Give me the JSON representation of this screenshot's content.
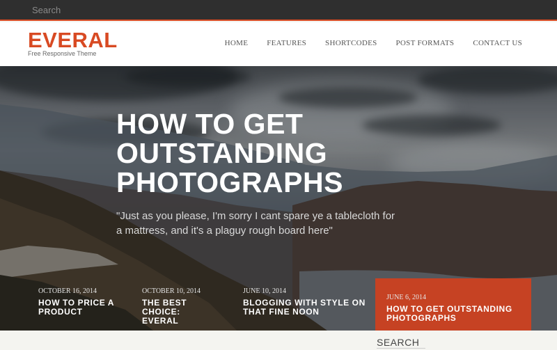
{
  "topbar": {
    "search_placeholder": "Search"
  },
  "header": {
    "logo": "EVERAL",
    "tagline": "Free Responsive Theme",
    "nav": [
      "HOME",
      "FEATURES",
      "SHORTCODES",
      "POST FORMATS",
      "CONTACT US"
    ]
  },
  "hero": {
    "title": "HOW TO GET OUTSTANDING PHOTOGRAPHS",
    "quote": "\"Just as you please, I'm sorry I cant spare ye a tablecloth for a mattress, and it's a plaguy rough board here\""
  },
  "posts": [
    {
      "date": "OCTOBER 16, 2014",
      "title": "HOW TO PRICE A PRODUCT"
    },
    {
      "date": "OCTOBER 10, 2014",
      "title": "THE BEST CHOICE: EVERAL"
    },
    {
      "date": "JUNE 10, 2014",
      "title": "BLOGGING WITH STYLE ON THAT FINE NOON"
    },
    {
      "date": "JUNE 6, 2014",
      "title": "HOW TO GET OUTSTANDING PHOTOGRAPHS"
    }
  ],
  "sidebar": {
    "search_heading": "SEARCH"
  },
  "colors": {
    "accent": "#d84a23",
    "active_post": "#c64223",
    "topbar": "#2f2f2f"
  }
}
